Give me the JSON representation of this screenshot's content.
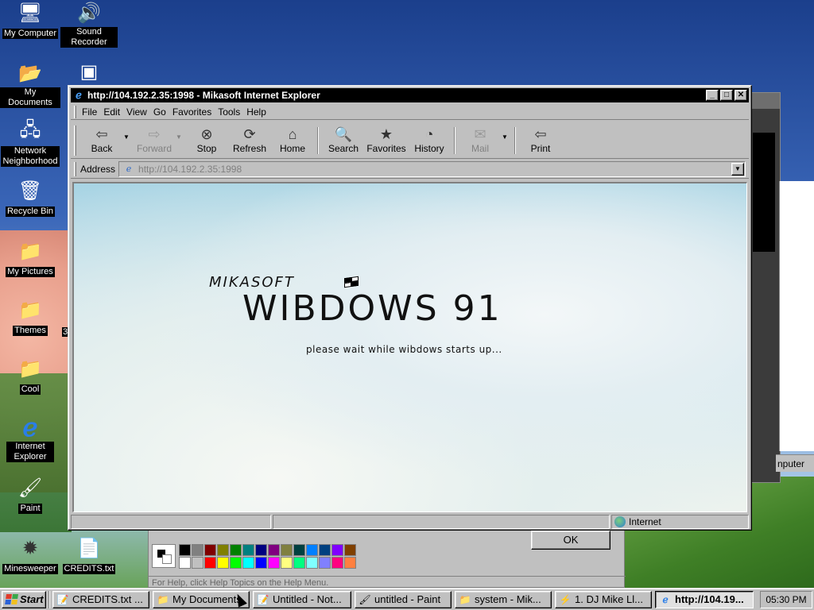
{
  "desktop": {
    "icons": [
      {
        "label": "My Computer",
        "icon": "computer-icon",
        "glyph": "🖥"
      },
      {
        "label": "Sound Recorder",
        "icon": "speaker-icon",
        "glyph": "🔊"
      },
      {
        "label": "My Documents",
        "icon": "folder-icon",
        "glyph": "📂"
      },
      {
        "label": "Network Neighborhood",
        "icon": "network-icon",
        "glyph": "🖧"
      },
      {
        "label": "Recycle Bin",
        "icon": "recycle-bin-icon",
        "glyph": "🗑"
      },
      {
        "label": "My Pictures",
        "icon": "folder-icon",
        "glyph": "📁"
      },
      {
        "label": "Themes",
        "icon": "folder-icon",
        "glyph": "📁"
      },
      {
        "label": "Cool",
        "icon": "folder-icon",
        "glyph": "📁"
      },
      {
        "label": "Internet Explorer",
        "icon": "internet-explorer-icon",
        "glyph": "ℯ"
      },
      {
        "label": "Paint",
        "icon": "paint-icon",
        "glyph": "🖌"
      },
      {
        "label": "Minesweeper",
        "icon": "mine-icon",
        "glyph": "✹"
      },
      {
        "label": "CREDITS.txt",
        "icon": "text-file-icon",
        "glyph": "📄"
      }
    ],
    "themes_suffix": "3"
  },
  "background_window": {
    "status_text": "nputer"
  },
  "paint_window": {
    "status_text": "For Help, click Help Topics on the Help Menu.",
    "ok_label": "OK",
    "palette_row1": [
      "#000000",
      "#808080",
      "#800000",
      "#808000",
      "#008000",
      "#008080",
      "#000080",
      "#800080",
      "#808040",
      "#004040",
      "#0080ff",
      "#004080",
      "#8000ff",
      "#804000"
    ],
    "palette_row2": [
      "#ffffff",
      "#c0c0c0",
      "#ff0000",
      "#ffff00",
      "#00ff00",
      "#00ffff",
      "#0000ff",
      "#ff00ff",
      "#ffff80",
      "#00ff80",
      "#80ffff",
      "#8080ff",
      "#ff0080",
      "#ff8040"
    ]
  },
  "browser": {
    "title": "http://104.192.2.35:1998 - Mikasoft Internet Explorer",
    "title_buttons": {
      "minimize": "_",
      "maximize": "□",
      "close": "✕"
    },
    "menu": [
      "File",
      "Edit",
      "View",
      "Go",
      "Favorites",
      "Tools",
      "Help"
    ],
    "toolbar": [
      {
        "label": "Back",
        "glyph": "⇦",
        "icon": "back-arrow-icon",
        "disabled": false,
        "dropdown": true
      },
      {
        "label": "Forward",
        "glyph": "⇨",
        "icon": "forward-arrow-icon",
        "disabled": true,
        "dropdown": true
      },
      {
        "label": "Stop",
        "glyph": "⊗",
        "icon": "stop-icon",
        "disabled": false,
        "dropdown": false
      },
      {
        "label": "Refresh",
        "glyph": "⟳",
        "icon": "refresh-icon",
        "disabled": false,
        "dropdown": false
      },
      {
        "label": "Home",
        "glyph": "⌂",
        "icon": "home-icon",
        "disabled": false,
        "dropdown": false
      },
      {
        "label": "Search",
        "glyph": "🔍",
        "icon": "search-icon",
        "disabled": false,
        "dropdown": false
      },
      {
        "label": "Favorites",
        "glyph": "★",
        "icon": "favorites-icon",
        "disabled": false,
        "dropdown": false
      },
      {
        "label": "History",
        "glyph": "◔",
        "icon": "history-icon",
        "disabled": false,
        "dropdown": false
      },
      {
        "label": "Mail",
        "glyph": "✉",
        "icon": "mail-icon",
        "disabled": true,
        "dropdown": true
      },
      {
        "label": "Print",
        "glyph": "⇦",
        "icon": "print-icon",
        "disabled": false,
        "dropdown": false
      }
    ],
    "address_label": "Address",
    "address_value": "http://104.192.2.35:1998",
    "status_zone": "Internet"
  },
  "page": {
    "brand_small": "MIKASOFT",
    "brand_large": "WIBDOWS 91",
    "loading_text": "please wait while wibdows starts up..."
  },
  "taskbar": {
    "start_label": "Start",
    "tasks": [
      {
        "label": "CREDITS.txt ...",
        "icon": "notepad-icon",
        "glyph": "📝",
        "active": false
      },
      {
        "label": "My Documents",
        "icon": "folder-icon",
        "glyph": "📁",
        "active": false
      },
      {
        "label": "Untitled - Not...",
        "icon": "notepad-icon",
        "glyph": "📝",
        "active": false
      },
      {
        "label": "untitled - Paint",
        "icon": "paint-icon",
        "glyph": "🖌",
        "active": false
      },
      {
        "label": "system - Mik...",
        "icon": "folder-icon",
        "glyph": "📁",
        "active": false
      },
      {
        "label": "1. DJ Mike Ll...",
        "icon": "media-icon",
        "glyph": "⚡",
        "active": false
      },
      {
        "label": "http://104.19...",
        "icon": "internet-explorer-icon",
        "glyph": "ℯ",
        "active": true
      }
    ],
    "clock": "05:30 PM"
  }
}
